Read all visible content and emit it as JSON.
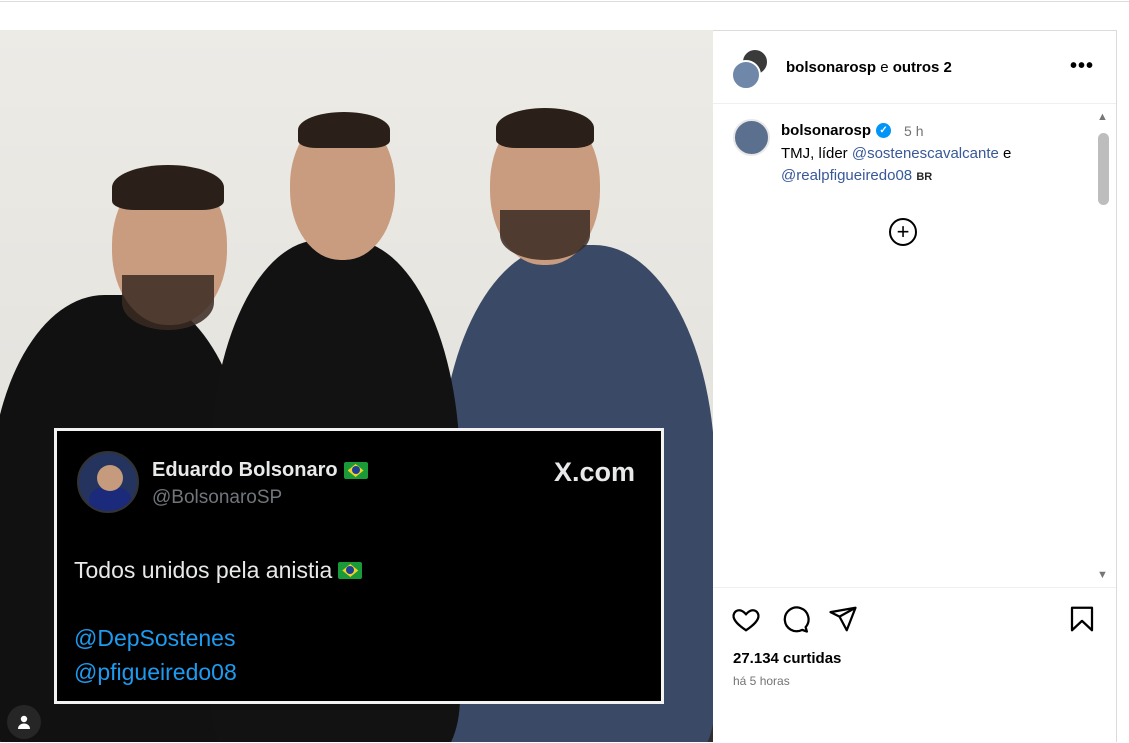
{
  "post": {
    "header_user": "bolsonarosp",
    "header_joiner": "e",
    "header_others": "outros 2",
    "more_label": "•••",
    "caption_user": "bolsonarosp",
    "caption_time": "5 h",
    "caption_text_start": "TMJ, líder",
    "mention_1": "@sostenescavalcante",
    "caption_joiner": "e",
    "mention_2": "@realpfigueiredo08",
    "country": "BR",
    "likes": "27.134 curtidas",
    "posted_ago": "há 5 horas"
  },
  "tweet": {
    "name": "Eduardo Bolsonaro",
    "handle": "@BolsonaroSP",
    "site": "X.com",
    "text": "Todos unidos pela anistia",
    "mention_1": "@DepSostenes",
    "mention_2": "@pfigueiredo08"
  },
  "icons": {
    "like": "heart-icon",
    "comment": "comment-icon",
    "share": "share-icon",
    "save": "bookmark-icon",
    "add": "plus-circle-icon",
    "user": "user-icon",
    "verified": "verified-icon"
  },
  "colors": {
    "link": "#385898",
    "verified": "#0095f6",
    "tweet_mention": "#1d9bf0"
  }
}
